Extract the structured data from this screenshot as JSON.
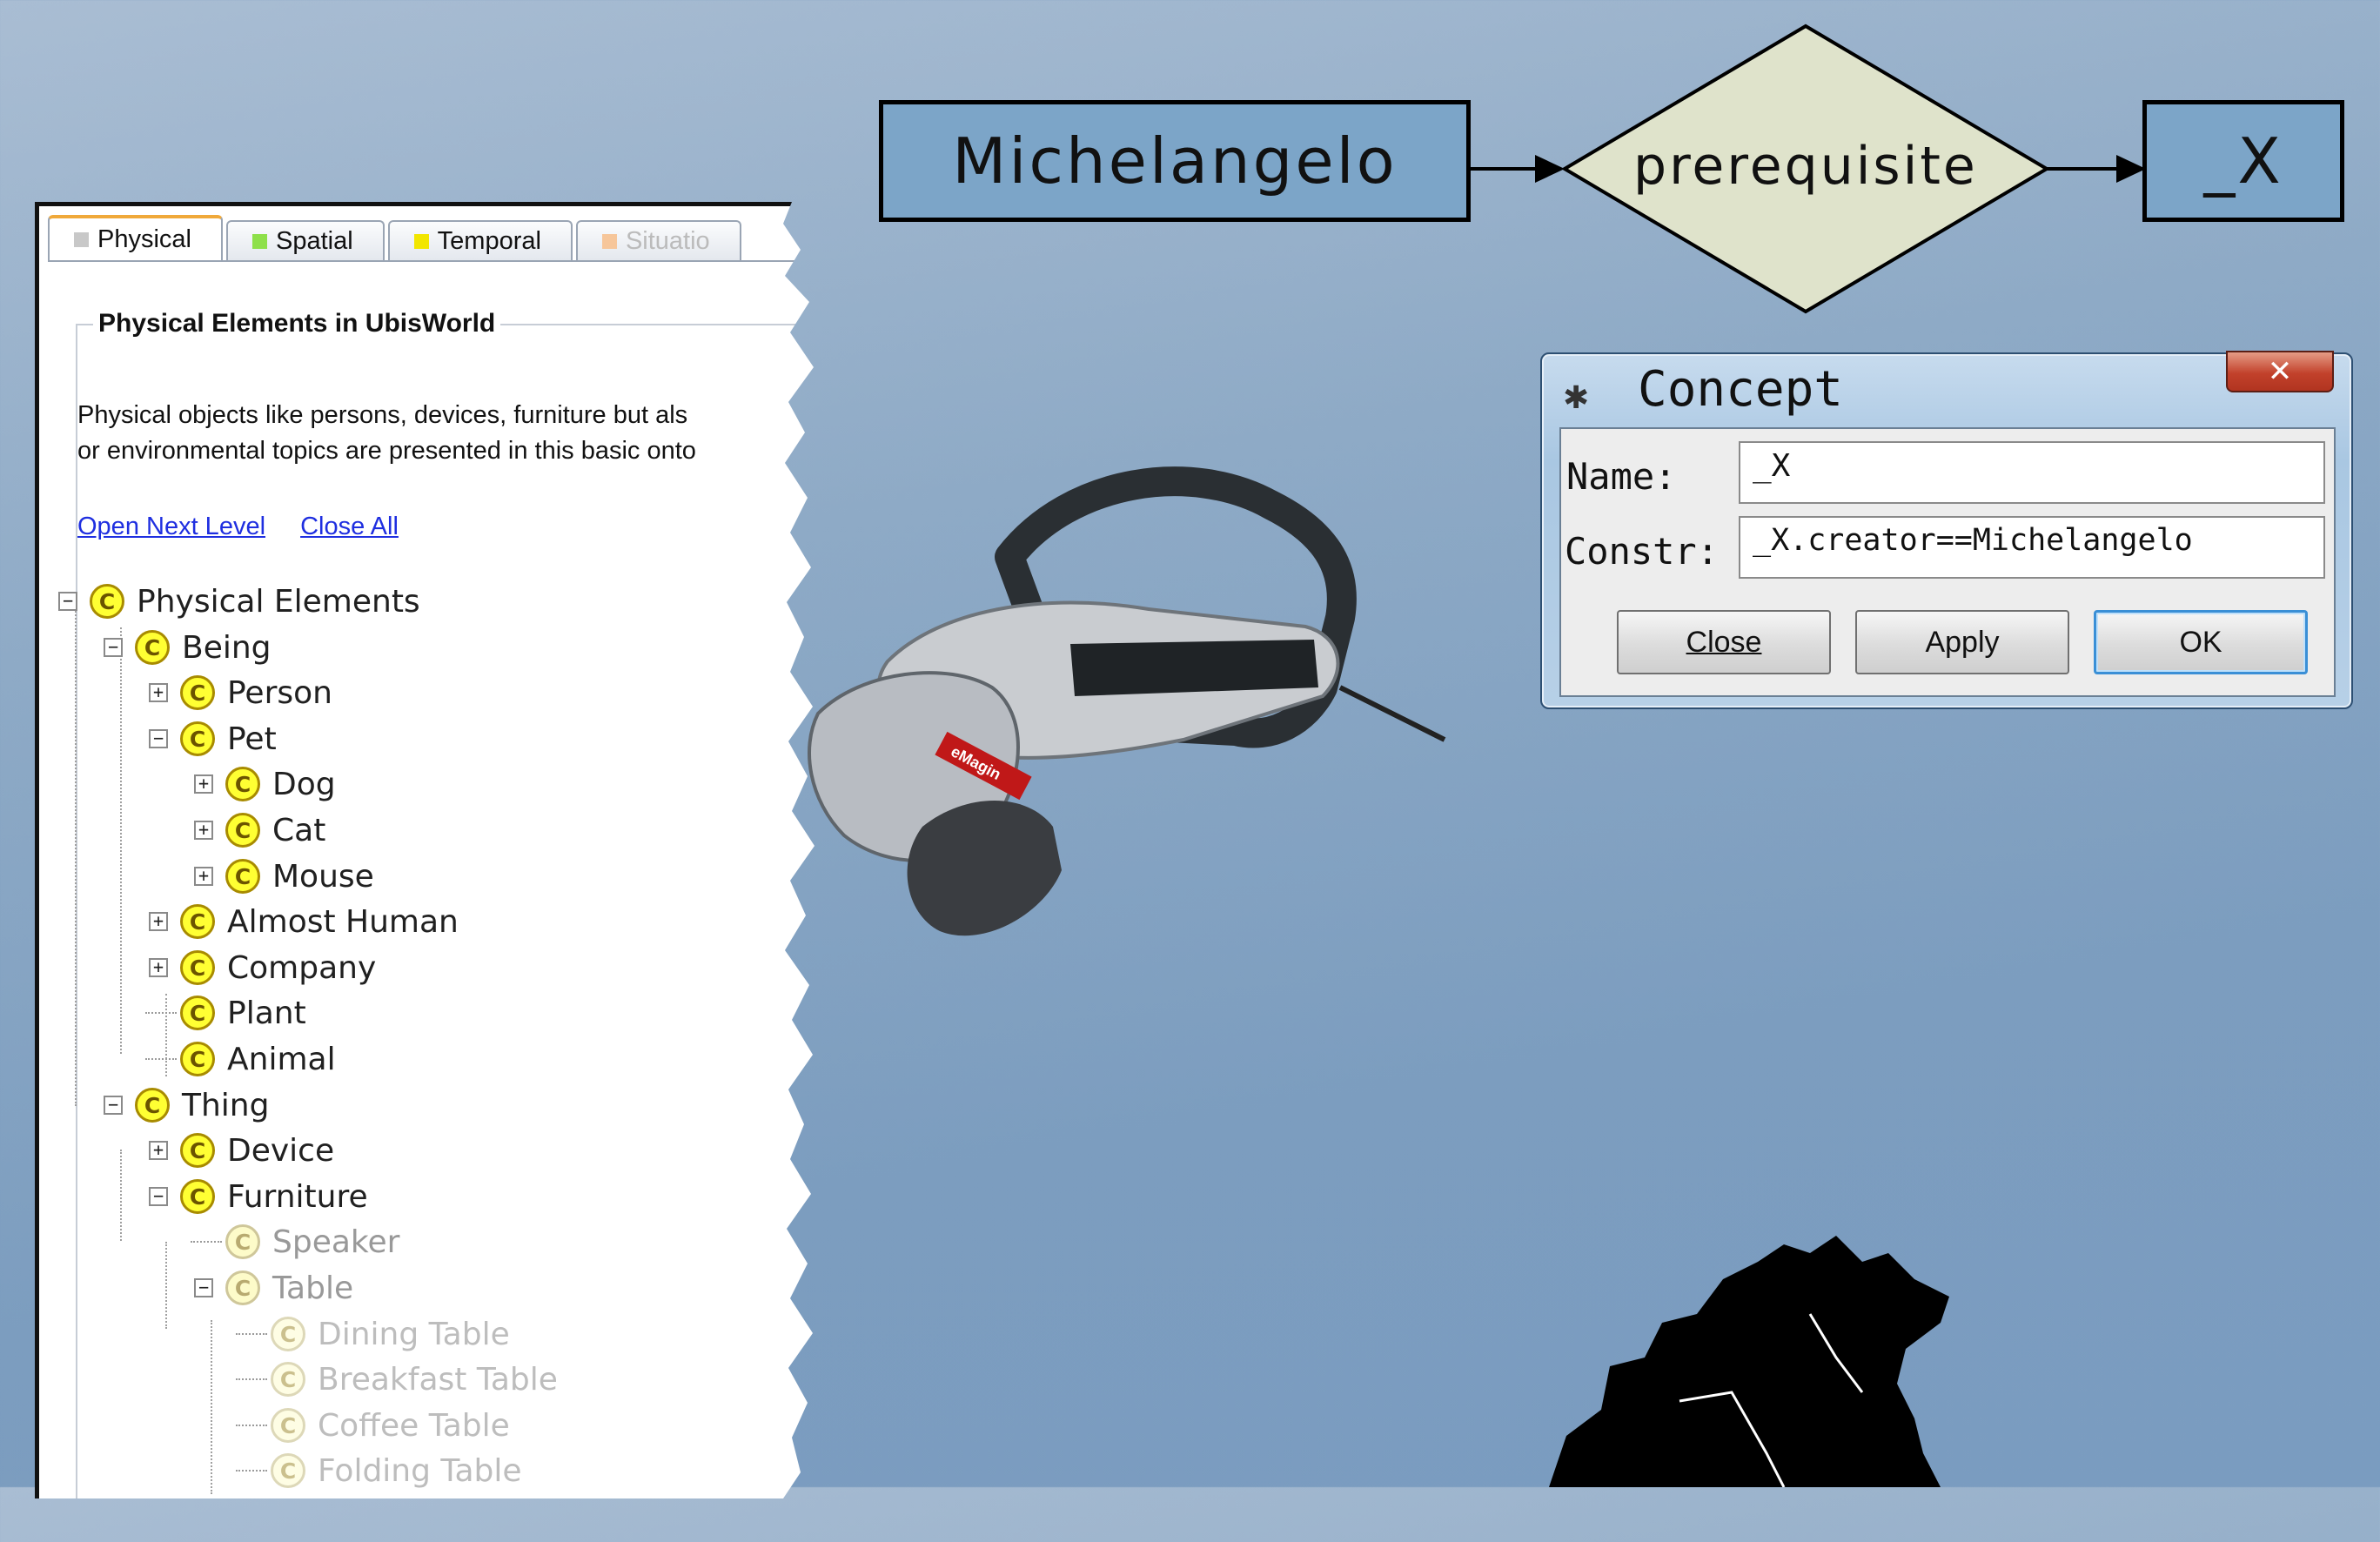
{
  "ontology_panel": {
    "tabs": [
      {
        "label": "Physical",
        "color": "#c8c8c8",
        "active": true
      },
      {
        "label": "Spatial",
        "color": "#8ee04a",
        "active": false
      },
      {
        "label": "Temporal",
        "color": "#f2e600",
        "active": false
      },
      {
        "label": "Situatio",
        "color": "#f6c69a",
        "active": false
      }
    ],
    "section_title": "Physical Elements in UbisWorld",
    "description": [
      "Physical objects like persons, devices, furniture but als",
      "or environmental topics are presented in this basic onto"
    ],
    "links": {
      "open_next_level": "Open Next Level",
      "close_all": "Close All"
    },
    "tree_icon_letter": "C",
    "tree": [
      {
        "label": "Physical Elements",
        "level": 0,
        "toggle": "−",
        "style": ""
      },
      {
        "label": "Being",
        "level": 1,
        "toggle": "−",
        "style": ""
      },
      {
        "label": "Person",
        "level": 2,
        "toggle": "+",
        "style": ""
      },
      {
        "label": "Pet",
        "level": 2,
        "toggle": "−",
        "style": ""
      },
      {
        "label": "Dog",
        "level": 3,
        "toggle": "+",
        "style": ""
      },
      {
        "label": "Cat",
        "level": 3,
        "toggle": "+",
        "style": ""
      },
      {
        "label": "Mouse",
        "level": 3,
        "toggle": "+",
        "style": ""
      },
      {
        "label": "Almost Human",
        "level": 2,
        "toggle": "+",
        "style": ""
      },
      {
        "label": "Company",
        "level": 2,
        "toggle": "+",
        "style": ""
      },
      {
        "label": "Plant",
        "level": 2,
        "toggle": "",
        "style": ""
      },
      {
        "label": "Animal",
        "level": 2,
        "toggle": "",
        "style": ""
      },
      {
        "label": "Thing",
        "level": 1,
        "toggle": "−",
        "style": ""
      },
      {
        "label": "Device",
        "level": 2,
        "toggle": "+",
        "style": ""
      },
      {
        "label": "Furniture",
        "level": 2,
        "toggle": "−",
        "style": ""
      },
      {
        "label": "Speaker",
        "level": 3,
        "toggle": "",
        "style": "dim"
      },
      {
        "label": "Table",
        "level": 3,
        "toggle": "−",
        "style": "dim"
      },
      {
        "label": "Dining Table",
        "level": 4,
        "toggle": "",
        "style": "dimmer"
      },
      {
        "label": "Breakfast Table",
        "level": 4,
        "toggle": "",
        "style": "dimmer"
      },
      {
        "label": "Coffee Table",
        "level": 4,
        "toggle": "",
        "style": "dimmer"
      },
      {
        "label": "Folding Table",
        "level": 4,
        "toggle": "",
        "style": "dimmer"
      }
    ]
  },
  "concept_graph": {
    "source": "Michelangelo",
    "relation": "prerequisite",
    "target": "_X",
    "box_color": "#7ca5c8",
    "relation_color": "#dfe3cb"
  },
  "concept_dialog": {
    "title": "Concept",
    "close_glyph": "✕",
    "name_label": "Name:",
    "name_value": "_X",
    "constr_label": "Constr:",
    "constr_value": "_X.creator==Michelangelo",
    "buttons": {
      "close": "Close",
      "apply": "Apply",
      "ok": "OK"
    }
  },
  "decorations": {
    "headset_brand": "eMagin"
  }
}
